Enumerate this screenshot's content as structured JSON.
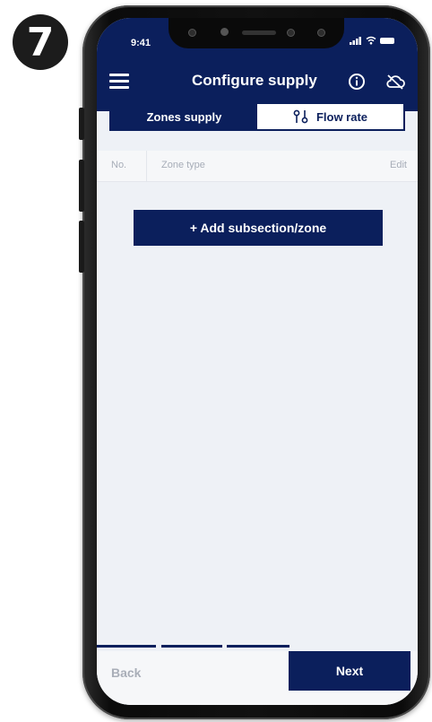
{
  "step": {
    "number": "7"
  },
  "status_bar": {
    "time": "9:41"
  },
  "header": {
    "title": "Configure supply",
    "menu_icon": "hamburger-menu-icon",
    "info_icon": "info-icon",
    "cloud_icon": "cloud-off-icon"
  },
  "tabs": [
    {
      "label": "Zones supply",
      "active": true
    },
    {
      "label": "Flow rate",
      "active": false,
      "icon": "flow-rate-icon"
    }
  ],
  "table": {
    "columns": [
      "No.",
      "Zone type",
      "Edit"
    ]
  },
  "add_button": {
    "label": "+ Add subsection/zone"
  },
  "footer": {
    "back_label": "Back",
    "next_label": "Next"
  },
  "colors": {
    "primary": "#0b1f5c",
    "screen_background": "#eef1f6",
    "muted_text": "#a9aeb8"
  }
}
